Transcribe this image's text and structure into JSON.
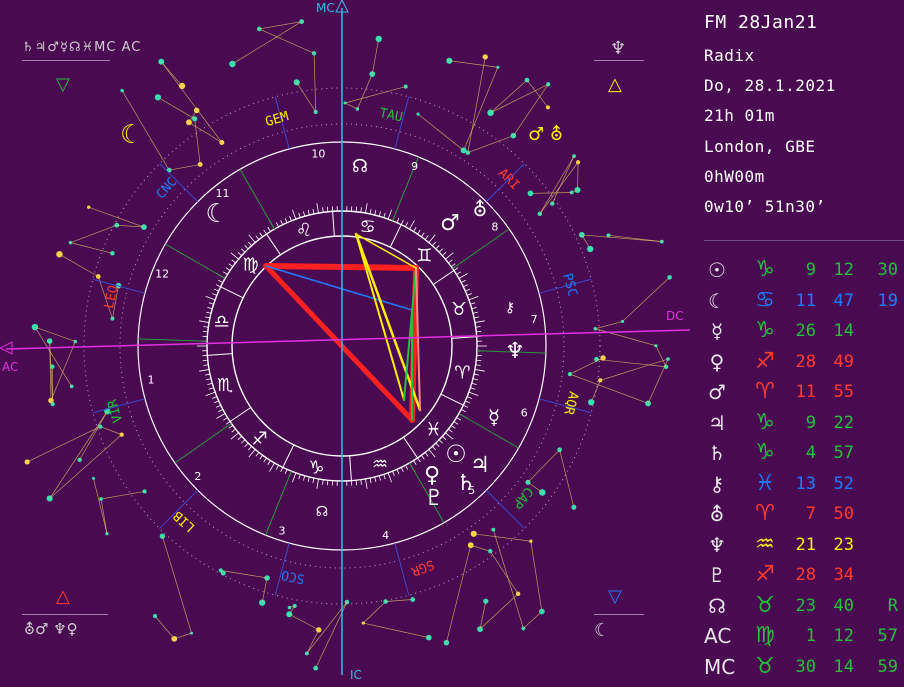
{
  "info": {
    "title": "FM 28Jan21",
    "chart_type": "Radix",
    "date": "Do, 28.1.2021",
    "time": "21h 01m",
    "place": "London, GBE",
    "zone": "0hW00m",
    "coords": "0w10’  51n30’"
  },
  "axes": {
    "mc": "MC",
    "ic": "IC",
    "ac": "AC",
    "dc": "DC"
  },
  "signs_outer": [
    "ARI",
    "TAU",
    "GEM",
    "CNC",
    "LEO",
    "VIR",
    "LIB",
    "SCO",
    "SGR",
    "CAP",
    "AQR",
    "PSC"
  ],
  "house_numbers": [
    "1",
    "2",
    "3",
    "4",
    "5",
    "6",
    "7",
    "8",
    "9",
    "10",
    "11",
    "12"
  ],
  "colors": {
    "fire": "#ff3b2e",
    "earth": "#23c23a",
    "air": "#ffee00",
    "water": "#1e7bff",
    "background": "#4a0a52"
  },
  "positions": [
    {
      "icon": "sun-icon",
      "planet": "☉",
      "sign": "♑",
      "color": "#23c23a",
      "deg": "9",
      "min": "12",
      "sec": "30"
    },
    {
      "icon": "moon-icon",
      "planet": "☾",
      "sign": "♋",
      "color": "#1e7bff",
      "deg": "11",
      "min": "47",
      "sec": "19"
    },
    {
      "icon": "mercury-icon",
      "planet": "☿",
      "sign": "♑",
      "color": "#23c23a",
      "deg": "26",
      "min": "14",
      "sec": ""
    },
    {
      "icon": "venus-icon",
      "planet": "♀",
      "sign": "♐",
      "color": "#ff3b2e",
      "deg": "28",
      "min": "49",
      "sec": ""
    },
    {
      "icon": "mars-icon",
      "planet": "♂",
      "sign": "♈",
      "color": "#ff3b2e",
      "deg": "11",
      "min": "55",
      "sec": ""
    },
    {
      "icon": "jupiter-icon",
      "planet": "♃",
      "sign": "♑",
      "color": "#23c23a",
      "deg": "9",
      "min": "22",
      "sec": ""
    },
    {
      "icon": "saturn-icon",
      "planet": "♄",
      "sign": "♑",
      "color": "#23c23a",
      "deg": "4",
      "min": "57",
      "sec": ""
    },
    {
      "icon": "chiron-icon",
      "planet": "⚷",
      "sign": "♓",
      "color": "#1e7bff",
      "deg": "13",
      "min": "52",
      "sec": ""
    },
    {
      "icon": "uranus-icon",
      "planet": "⛢",
      "sign": "♈",
      "color": "#ff3b2e",
      "deg": "7",
      "min": "50",
      "sec": ""
    },
    {
      "icon": "neptune-icon",
      "planet": "♆",
      "sign": "♒",
      "color": "#ffee00",
      "deg": "21",
      "min": "23",
      "sec": ""
    },
    {
      "icon": "pluto-icon",
      "planet": "♇",
      "sign": "♐",
      "color": "#ff3b2e",
      "deg": "28",
      "min": "34",
      "sec": ""
    },
    {
      "icon": "node-icon",
      "planet": "☊",
      "sign": "♉",
      "color": "#23c23a",
      "deg": "23",
      "min": "40",
      "sec": "",
      "retro": "R"
    },
    {
      "icon": "ascendant-icon",
      "planet": "AC",
      "sign": "♍",
      "color": "#23c23a",
      "deg": "1",
      "min": "12",
      "sec": "57"
    },
    {
      "icon": "midheaven-icon",
      "planet": "MC",
      "sign": "♉",
      "color": "#23c23a",
      "deg": "30",
      "min": "14",
      "sec": "59"
    }
  ],
  "corners": {
    "top_left": {
      "glyphs": "♄♃♂☿☊♓MC AC",
      "triangle": "▽",
      "triangle_color": "#23c23a",
      "moon": "☾"
    },
    "top_right": {
      "glyphs": "♆",
      "triangle": "△",
      "triangle_color": "#ffee00",
      "symbols": "♂ ⛢"
    },
    "bottom_left": {
      "glyphs": "⛢♂  ♆♀",
      "triangle": "△",
      "triangle_color": "#ff3b2e"
    },
    "bottom_right": {
      "glyphs": "☾",
      "triangle": "▽",
      "triangle_color": "#1e7bff"
    }
  }
}
